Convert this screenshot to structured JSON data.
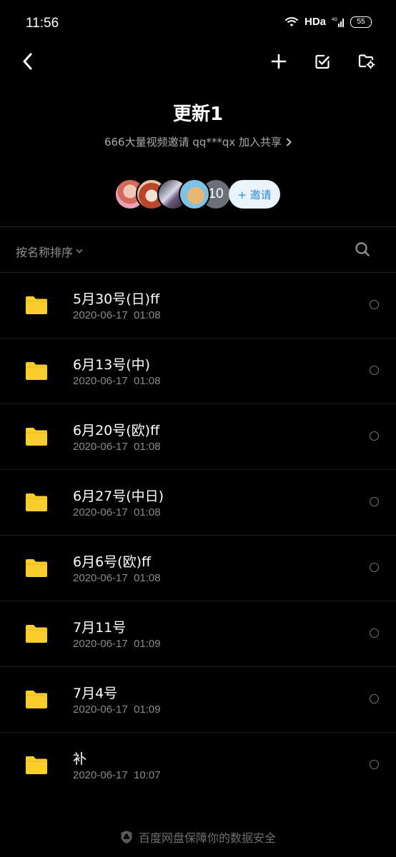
{
  "status_bar": {
    "time": "11:56",
    "network": "HDa",
    "battery": "55"
  },
  "nav": {
    "back_icon": "chevron-left-icon",
    "add_icon": "plus-icon",
    "select_icon": "checkbox-edit-icon",
    "folder_settings_icon": "folder-gear-icon"
  },
  "header": {
    "title": "更新1",
    "subtitle": "666大量视频邀请 qq***qx 加入共享"
  },
  "members": {
    "count": "10",
    "invite_label": "+ 邀请"
  },
  "sort": {
    "label": "按名称排序"
  },
  "files": [
    {
      "name": "5月30号(日)ff",
      "date": "2020-06-17  01:08"
    },
    {
      "name": "6月13号(中)",
      "date": "2020-06-17  01:08"
    },
    {
      "name": "6月20号(欧)ff",
      "date": "2020-06-17  01:08"
    },
    {
      "name": "6月27号(中日)",
      "date": "2020-06-17  01:08"
    },
    {
      "name": "6月6号(欧)ff",
      "date": "2020-06-17  01:08"
    },
    {
      "name": "7月11号",
      "date": "2020-06-17  01:09"
    },
    {
      "name": "7月4号",
      "date": "2020-06-17  01:09"
    },
    {
      "name": "补",
      "date": "2020-06-17  10:07"
    }
  ],
  "footer": {
    "text": "百度网盘保障你的数据安全"
  },
  "colors": {
    "background": "#000000",
    "folder": "#f8cd2c",
    "invite_bg": "#e9f3fc",
    "invite_text": "#2b8ad9"
  }
}
